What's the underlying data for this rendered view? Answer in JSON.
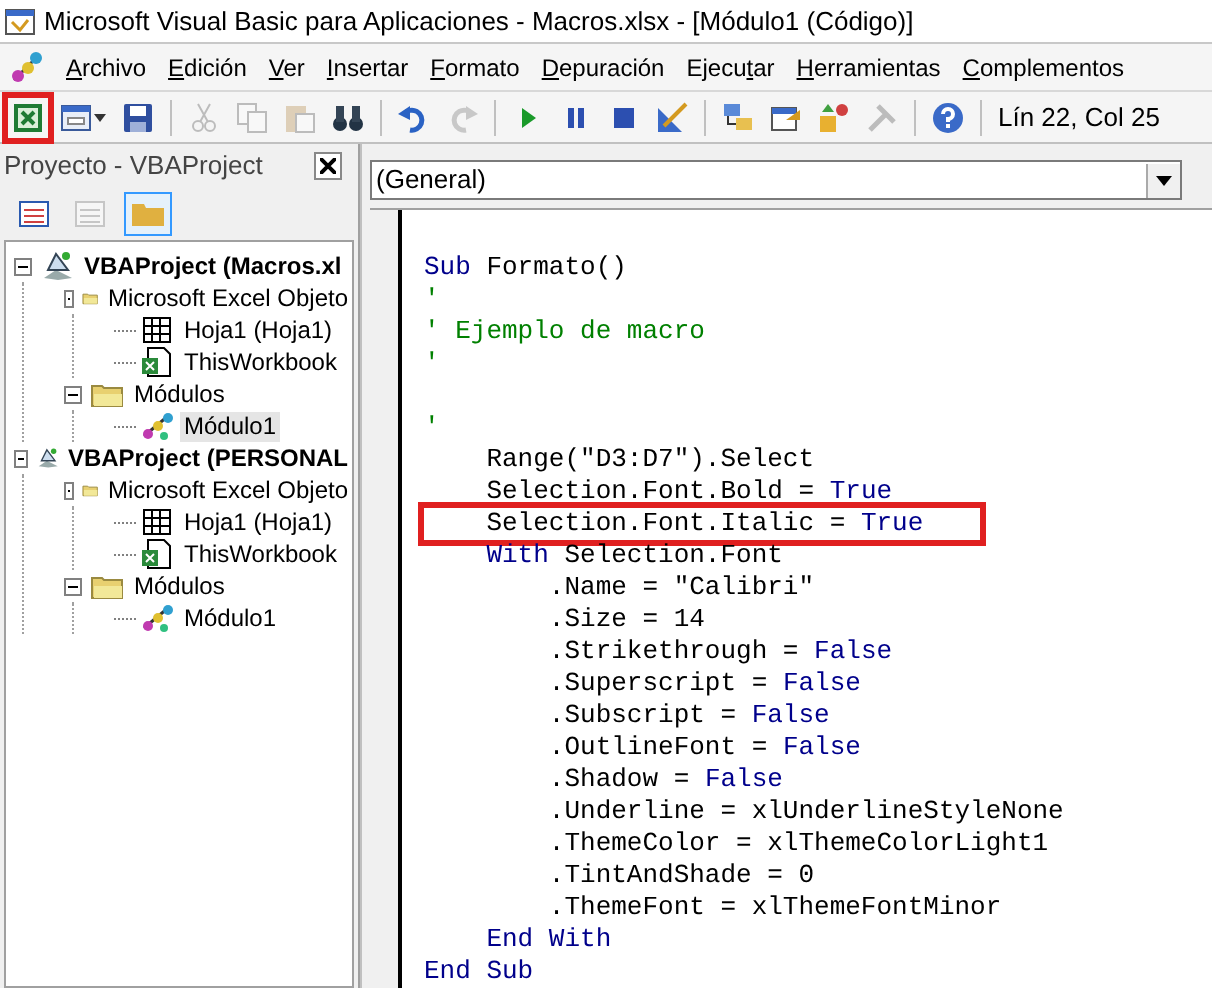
{
  "window": {
    "title": "Microsoft Visual Basic para Aplicaciones - Macros.xlsx - [Módulo1 (Código)]"
  },
  "menu": [
    {
      "access_key": "A",
      "after": "rchivo"
    },
    {
      "access_key": "E",
      "after": "dición"
    },
    {
      "access_key": "V",
      "after": "er"
    },
    {
      "access_key": "I",
      "after": "nsertar"
    },
    {
      "access_key": "F",
      "after": "ormato"
    },
    {
      "access_key": "D",
      "after": "epuración"
    },
    {
      "before": "Ejecu",
      "access_key": "t",
      "after": "ar"
    },
    {
      "access_key": "H",
      "after": "erramientas"
    },
    {
      "access_key": "C",
      "after": "omplementos"
    }
  ],
  "toolbar": [
    {
      "kind": "excel",
      "disabled": false,
      "highlighted": true
    },
    {
      "kind": "userform",
      "disabled": false,
      "highlighted": false
    },
    {
      "kind": "save",
      "disabled": false,
      "highlighted": false
    },
    {
      "kind": "separator"
    },
    {
      "kind": "cut",
      "disabled": true,
      "highlighted": false
    },
    {
      "kind": "copy",
      "disabled": true,
      "highlighted": false
    },
    {
      "kind": "paste",
      "disabled": true,
      "highlighted": false
    },
    {
      "kind": "find",
      "disabled": false,
      "highlighted": false
    },
    {
      "kind": "separator"
    },
    {
      "kind": "undo",
      "disabled": false,
      "highlighted": false
    },
    {
      "kind": "redo",
      "disabled": true,
      "highlighted": false
    },
    {
      "kind": "separator"
    },
    {
      "kind": "run",
      "disabled": false,
      "highlighted": false
    },
    {
      "kind": "pause",
      "disabled": false,
      "highlighted": false
    },
    {
      "kind": "stop",
      "disabled": false,
      "highlighted": false
    },
    {
      "kind": "design",
      "disabled": false,
      "highlighted": false
    },
    {
      "kind": "separator"
    },
    {
      "kind": "explorer",
      "disabled": false,
      "highlighted": false
    },
    {
      "kind": "properties",
      "disabled": false,
      "highlighted": false
    },
    {
      "kind": "browser",
      "disabled": false,
      "highlighted": false
    },
    {
      "kind": "toolbox",
      "disabled": true,
      "highlighted": false
    },
    {
      "kind": "separator"
    },
    {
      "kind": "help",
      "disabled": false,
      "highlighted": false
    },
    {
      "kind": "separator"
    }
  ],
  "cursor_position": "Lín 22, Col 25",
  "project_panel": {
    "title": "Proyecto - VBAProject",
    "tools": [
      {
        "kind": "code",
        "disabled": false,
        "selected": false
      },
      {
        "kind": "object",
        "disabled": true,
        "selected": false
      },
      {
        "kind": "folders",
        "disabled": false,
        "selected": true
      }
    ],
    "tree": [
      {
        "kind": "project",
        "label": "VBAProject (Macros.xl",
        "expanded": true,
        "selected": false,
        "children": [
          {
            "kind": "folder",
            "label": "Microsoft Excel Objeto",
            "expanded": true,
            "selected": false,
            "children": [
              {
                "kind": "sheet",
                "label": "Hoja1 (Hoja1)",
                "selected": false
              },
              {
                "kind": "workbook",
                "label": "ThisWorkbook",
                "selected": false
              }
            ]
          },
          {
            "kind": "folder",
            "label": "Módulos",
            "expanded": true,
            "selected": false,
            "children": [
              {
                "kind": "module",
                "label": "Módulo1",
                "selected": true
              }
            ]
          }
        ]
      },
      {
        "kind": "project",
        "label": "VBAProject (PERSONAL",
        "expanded": true,
        "selected": false,
        "children": [
          {
            "kind": "folder",
            "label": "Microsoft Excel Objeto",
            "expanded": true,
            "selected": false,
            "children": [
              {
                "kind": "sheet",
                "label": "Hoja1 (Hoja1)",
                "selected": false
              },
              {
                "kind": "workbook",
                "label": "ThisWorkbook",
                "selected": false
              }
            ]
          },
          {
            "kind": "folder",
            "label": "Módulos",
            "expanded": true,
            "selected": false,
            "children": [
              {
                "kind": "module",
                "label": "Módulo1",
                "selected": false
              }
            ]
          }
        ]
      }
    ]
  },
  "editor": {
    "object_box": "(General)",
    "lines": [
      {
        "highlighted": false,
        "tokens": [
          {
            "kind": "keyword",
            "text": "Sub"
          },
          {
            "kind": "plain",
            "text": " Formato()"
          }
        ]
      },
      {
        "highlighted": false,
        "tokens": [
          {
            "kind": "comment",
            "text": "'"
          }
        ]
      },
      {
        "highlighted": false,
        "tokens": [
          {
            "kind": "comment",
            "text": "' Ejemplo de macro"
          }
        ]
      },
      {
        "highlighted": false,
        "tokens": [
          {
            "kind": "comment",
            "text": "'"
          }
        ]
      },
      {
        "highlighted": false
      },
      {
        "highlighted": false,
        "tokens": [
          {
            "kind": "comment",
            "text": "'"
          }
        ]
      },
      {
        "highlighted": false,
        "tokens": [
          {
            "kind": "plain",
            "text": "    Range(\"D3:D7\").Select"
          }
        ]
      },
      {
        "highlighted": false,
        "tokens": [
          {
            "kind": "plain",
            "text": "    Selection.Font.Bold = "
          },
          {
            "kind": "keyword",
            "text": "True"
          }
        ]
      },
      {
        "highlighted": true,
        "tokens": [
          {
            "kind": "plain",
            "text": "    Selection.Font.Italic = "
          },
          {
            "kind": "keyword",
            "text": "True"
          }
        ]
      },
      {
        "highlighted": false,
        "tokens": [
          {
            "kind": "keyword",
            "text": "    With"
          },
          {
            "kind": "plain",
            "text": " Selection.Font"
          }
        ]
      },
      {
        "highlighted": false,
        "tokens": [
          {
            "kind": "plain",
            "text": "        .Name = \"Calibri\""
          }
        ]
      },
      {
        "highlighted": false,
        "tokens": [
          {
            "kind": "plain",
            "text": "        .Size = 14"
          }
        ]
      },
      {
        "highlighted": false,
        "tokens": [
          {
            "kind": "plain",
            "text": "        .Strikethrough = "
          },
          {
            "kind": "keyword",
            "text": "False"
          }
        ]
      },
      {
        "highlighted": false,
        "tokens": [
          {
            "kind": "plain",
            "text": "        .Superscript = "
          },
          {
            "kind": "keyword",
            "text": "False"
          }
        ]
      },
      {
        "highlighted": false,
        "tokens": [
          {
            "kind": "plain",
            "text": "        .Subscript = "
          },
          {
            "kind": "keyword",
            "text": "False"
          }
        ]
      },
      {
        "highlighted": false,
        "tokens": [
          {
            "kind": "plain",
            "text": "        .OutlineFont = "
          },
          {
            "kind": "keyword",
            "text": "False"
          }
        ]
      },
      {
        "highlighted": false,
        "tokens": [
          {
            "kind": "plain",
            "text": "        .Shadow = "
          },
          {
            "kind": "keyword",
            "text": "False"
          }
        ]
      },
      {
        "highlighted": false,
        "tokens": [
          {
            "kind": "plain",
            "text": "        .Underline = xlUnderlineStyleNone"
          }
        ]
      },
      {
        "highlighted": false,
        "tokens": [
          {
            "kind": "plain",
            "text": "        .ThemeColor = xlThemeColorLight1"
          }
        ]
      },
      {
        "highlighted": false,
        "tokens": [
          {
            "kind": "plain",
            "text": "        .TintAndShade = 0"
          }
        ]
      },
      {
        "highlighted": false,
        "tokens": [
          {
            "kind": "plain",
            "text": "        .ThemeFont = xlThemeFontMinor"
          }
        ]
      },
      {
        "highlighted": false,
        "tokens": [
          {
            "kind": "keyword",
            "text": "    End With"
          }
        ]
      },
      {
        "highlighted": false,
        "tokens": [
          {
            "kind": "keyword",
            "text": "End Sub"
          }
        ]
      }
    ]
  }
}
